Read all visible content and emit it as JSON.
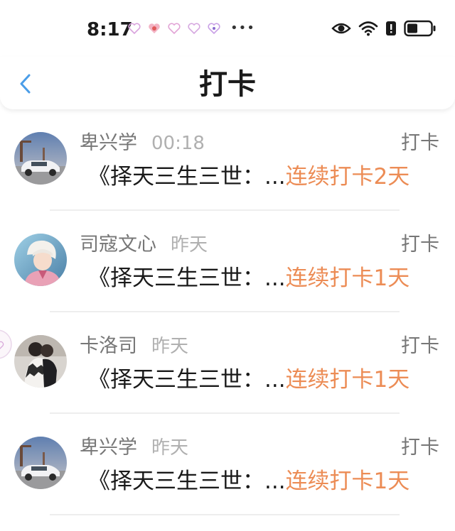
{
  "status_bar": {
    "time": "8:17",
    "more": "•••",
    "icons": [
      "heart-notification-icon",
      "eye-icon",
      "wifi-icon",
      "battery-icon"
    ]
  },
  "header": {
    "title": "打卡",
    "back_icon": "chevron-left-icon"
  },
  "colors": {
    "accent_orange": "#ec8c55",
    "back_blue": "#4a9de8",
    "text_gray": "#777777"
  },
  "rows": [
    {
      "name": "卑兴学",
      "time": "00:18",
      "action": "打卡",
      "book": "《择天三生三世：...",
      "streak": "连续打卡2天",
      "avatar": "car-avatar"
    },
    {
      "name": "司寇文心",
      "time": "昨天",
      "action": "打卡",
      "book": "《择天三生三世：...",
      "streak": "连续打卡1天",
      "avatar": "anime-avatar"
    },
    {
      "name": "卡洛司",
      "time": "昨天",
      "action": "打卡",
      "book": "《择天三生三世：...",
      "streak": "连续打卡1天",
      "avatar": "couple-avatar"
    },
    {
      "name": "卑兴学",
      "time": "昨天",
      "action": "打卡",
      "book": "《择天三生三世：...",
      "streak": "连续打卡1天",
      "avatar": "car-avatar"
    }
  ]
}
